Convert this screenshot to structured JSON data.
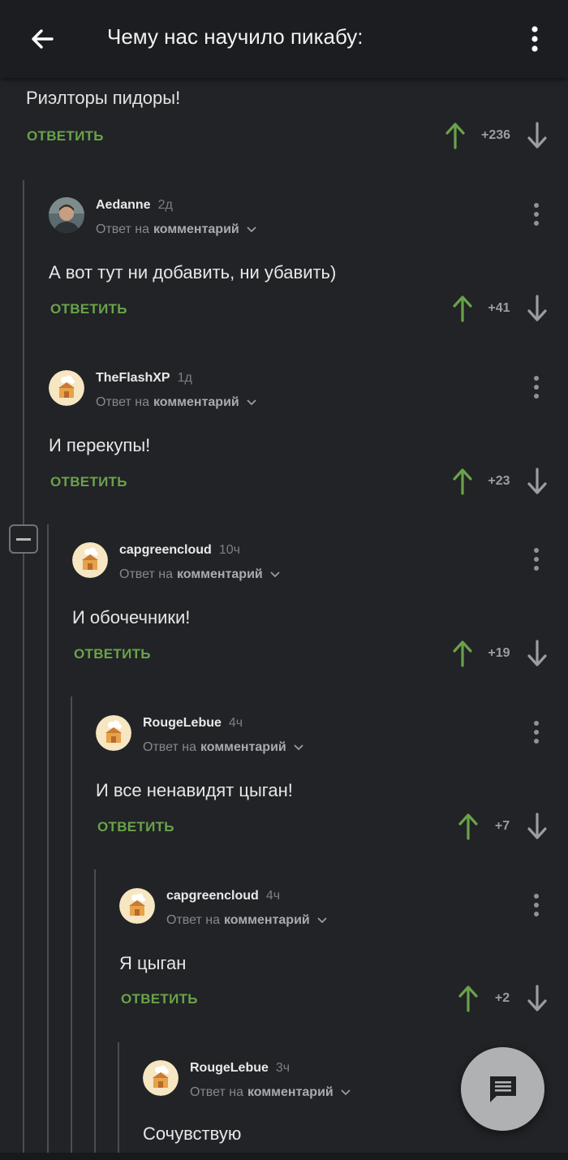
{
  "header": {
    "title": "Чему нас научило пикабу:",
    "back_icon": "arrow-left-icon",
    "menu_icon": "vertical-dots-icon"
  },
  "root_comment": {
    "text": "Риэлторы пидоры!",
    "reply_label": "ОТВЕТИТЬ",
    "score": "+236"
  },
  "comments": [
    {
      "author": "Aedanne",
      "time": "2д",
      "reply_prefix": "Ответ на",
      "reply_target": "комментарий",
      "text": "А вот тут ни добавить, ни убавить)",
      "reply_label": "ОТВЕТИТЬ",
      "score": "+41"
    },
    {
      "author": "TheFlashXP",
      "time": "1д",
      "reply_prefix": "Ответ на",
      "reply_target": "комментарий",
      "text": "И перекупы!",
      "reply_label": "ОТВЕТИТЬ",
      "score": "+23"
    },
    {
      "author": "capgreencloud",
      "time": "10ч",
      "reply_prefix": "Ответ на",
      "reply_target": "комментарий",
      "text": "И обочечники!",
      "reply_label": "ОТВЕТИТЬ",
      "score": "+19"
    },
    {
      "author": "RougeLebue",
      "time": "4ч",
      "reply_prefix": "Ответ на",
      "reply_target": "комментарий",
      "text": "И все ненавидят цыган!",
      "reply_label": "ОТВЕТИТЬ",
      "score": "+7"
    },
    {
      "author": "capgreencloud",
      "time": "4ч",
      "reply_prefix": "Ответ на",
      "reply_target": "комментарий",
      "text": "Я цыган",
      "reply_label": "ОТВЕТИТЬ",
      "score": "+2"
    },
    {
      "author": "RougeLebue",
      "time": "3ч",
      "reply_prefix": "Ответ на",
      "reply_target": "комментарий",
      "text": "Сочувствую",
      "reply_label": "",
      "score": ""
    }
  ],
  "colors": {
    "background": "#212326",
    "accent_green": "#6aa24a",
    "score_gray": "#9a9da2"
  },
  "fab": {
    "icon": "comment-icon"
  }
}
